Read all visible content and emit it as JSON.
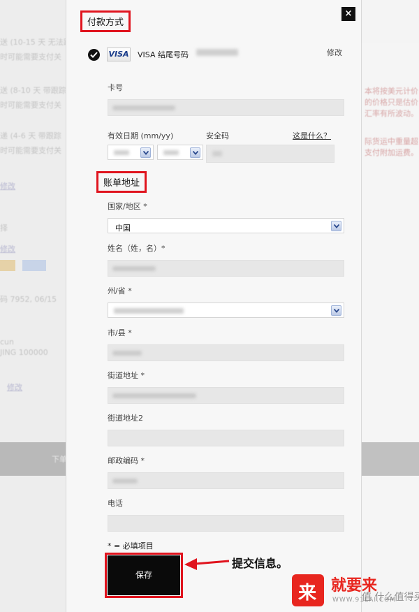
{
  "background": {
    "left_lines": [
      "送 (10-15 天 无法跟",
      "时可能需要支付关",
      "送 (8-10 天 带跟踪",
      "时可能需要支付关",
      "递 (4-6 天 带跟踪",
      "时可能需要支付关",
      "修改",
      "择",
      "修改",
      "码 7952, 06/15",
      "cun",
      "JING 100000",
      "修改",
      "下单"
    ],
    "right_lines": [
      "本将按美元计价",
      "的价格只是估价",
      "汇率有所波动。",
      "际货运中重量超",
      "支付附加运费。"
    ]
  },
  "modal": {
    "close_label": "×",
    "payment": {
      "title": "付款方式",
      "card_brand": "VISA",
      "card_desc": "VISA 结尾号码",
      "edit_label": "修改",
      "card_number_label": "卡号",
      "expiry_label": "有效日期 (mm/yy)",
      "cvv_label": "安全码",
      "whats_this": "这是什么？"
    },
    "billing": {
      "title": "账单地址",
      "country_label": "国家/地区 *",
      "country_value": "中国",
      "name_label": "姓名（姓，名）*",
      "state_label": "州/省 *",
      "city_label": "市/县 *",
      "street_label": "街道地址 *",
      "street2_label": "街道地址2",
      "zip_label": "邮政编码 *",
      "phone_label": "电话"
    },
    "required_note": "* = 必填项目",
    "save_label": "保存"
  },
  "annotation": {
    "text": "提交信息。"
  },
  "watermark": {
    "name": "就要来",
    "url": "WWW.91LAI.COM",
    "side_text": "值 什么值得买"
  },
  "colors": {
    "highlight_red": "#e0141e",
    "button_black": "#0a0a0a",
    "watermark_red": "#e8261f"
  }
}
